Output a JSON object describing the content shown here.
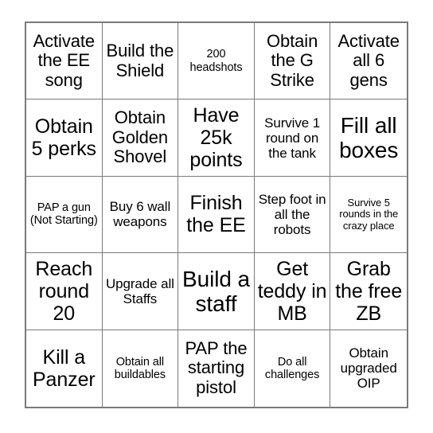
{
  "card": {
    "type": "bingo-card",
    "columns": 5,
    "rows": 5,
    "background_color": "#ffffff",
    "border_color": "#7a7a7a",
    "text_color": "#000000",
    "cells": [
      {
        "text": "Activate the EE song",
        "size": "fs-md"
      },
      {
        "text": "Build the Shield",
        "size": "fs-md"
      },
      {
        "text": "200 headshots",
        "size": "fs-xs"
      },
      {
        "text": "Obtain the G Strike",
        "size": "fs-md"
      },
      {
        "text": "Activate all 6 gens",
        "size": "fs-md"
      },
      {
        "text": "Obtain 5 perks",
        "size": "fs-lg"
      },
      {
        "text": "Obtain Golden Shovel",
        "size": "fs-md"
      },
      {
        "text": "Have 25k points",
        "size": "fs-lg"
      },
      {
        "text": "Survive 1 round on the tank",
        "size": "fs-sm"
      },
      {
        "text": "Fill all boxes",
        "size": "fs-xl"
      },
      {
        "text": "PAP a gun (Not Starting)",
        "size": "fs-xs"
      },
      {
        "text": "Buy 6 wall weapons",
        "size": "fs-sm"
      },
      {
        "text": "Finish the EE",
        "size": "fs-lg"
      },
      {
        "text": "Step foot in all the robots",
        "size": "fs-sm"
      },
      {
        "text": "Survive 5 rounds in the crazy place",
        "size": "fs-xxs"
      },
      {
        "text": "Reach round 20",
        "size": "fs-lg"
      },
      {
        "text": "Upgrade all Staffs",
        "size": "fs-sm"
      },
      {
        "text": "Build a staff",
        "size": "fs-xl"
      },
      {
        "text": "Get teddy in MB",
        "size": "fs-lg"
      },
      {
        "text": "Grab the free ZB",
        "size": "fs-lg"
      },
      {
        "text": "Kill a Panzer",
        "size": "fs-lg"
      },
      {
        "text": "Obtain all buildables",
        "size": "fs-xs"
      },
      {
        "text": "PAP the starting pistol",
        "size": "fs-md"
      },
      {
        "text": "Do all challenges",
        "size": "fs-xs"
      },
      {
        "text": "Obtain upgraded OIP",
        "size": "fs-sm"
      }
    ]
  }
}
